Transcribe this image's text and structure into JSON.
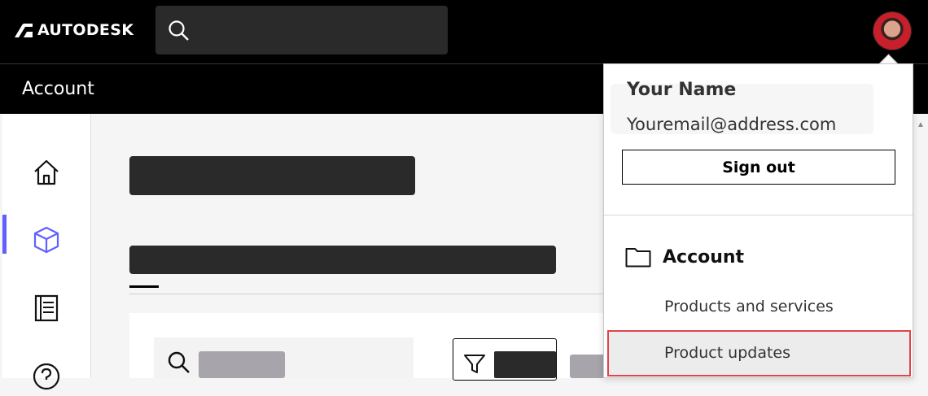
{
  "brand": {
    "logo_text": "AUTODESK"
  },
  "header": {
    "search_placeholder": ""
  },
  "account_bar": {
    "title": "Account"
  },
  "sidebar": {
    "items": [
      {
        "icon": "home-icon"
      },
      {
        "icon": "cube-icon",
        "active": true
      },
      {
        "icon": "ledger-icon"
      },
      {
        "icon": "help-icon"
      }
    ]
  },
  "dropdown": {
    "user_name": "Your Name",
    "user_email": "Youremail@address.com",
    "sign_out_label": "Sign out",
    "section_label": "Account",
    "menu_items": [
      "Products and services",
      "Product updates"
    ],
    "highlighted_item": "Product updates"
  },
  "colors": {
    "accent": "#5f60ff",
    "highlight_border": "#e0454a",
    "topbar": "#000000"
  }
}
